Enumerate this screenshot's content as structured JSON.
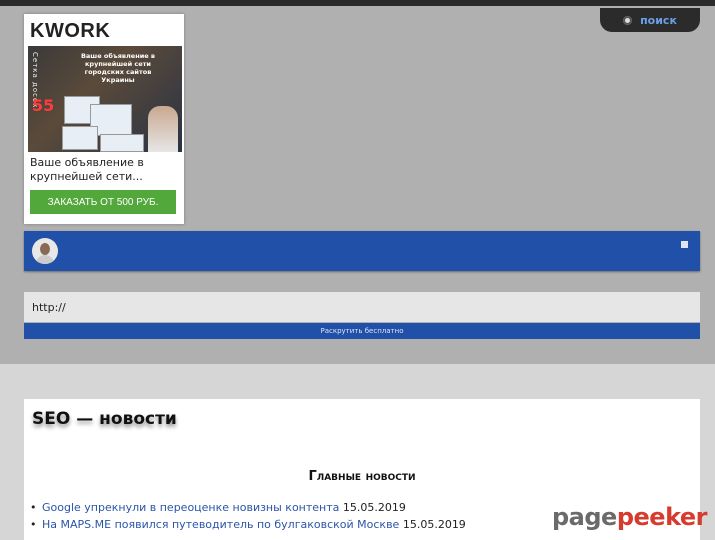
{
  "search_tab": {
    "label": "поиск"
  },
  "ad": {
    "logo": "KWORK",
    "side_text": "Сетка досок",
    "promo_text": "Ваше объявление в крупнейшей сети городских сайтов Украины",
    "number": "55",
    "text": "Ваше объявление в крупнейшей сети...",
    "button_label": "ЗАКАЗАТЬ ОТ 500 РУБ."
  },
  "url_form": {
    "input_value": "http://",
    "button_label": "Раскрутить бесплатно"
  },
  "content": {
    "title": "SEO — новости",
    "subtitle": "Главные новости",
    "news": [
      {
        "title": "Google упрекнули в переоценке новизны контента",
        "date": "15.05.2019"
      },
      {
        "title": "На MAPS.ME появился путеводитель по булгаковской Москве",
        "date": "15.05.2019"
      }
    ]
  },
  "watermark": {
    "part1": "page",
    "part2": "peeker"
  },
  "colors": {
    "blue": "#2050a8",
    "green": "#52a83b",
    "link": "#2a55a8",
    "watermark_red": "#d63b2e"
  }
}
